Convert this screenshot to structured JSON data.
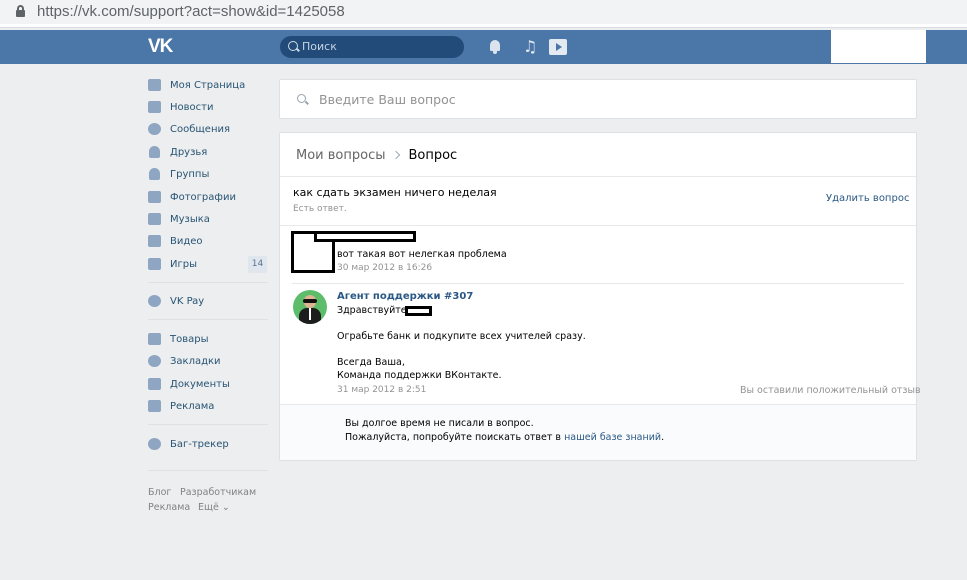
{
  "browser": {
    "url": "https://vk.com/support?act=show&id=1425058"
  },
  "header": {
    "logo": "VK",
    "search_placeholder": "Поиск"
  },
  "sidebar": {
    "items": [
      {
        "label": "Моя Страница",
        "icon": "home-icon"
      },
      {
        "label": "Новости",
        "icon": "news-icon"
      },
      {
        "label": "Сообщения",
        "icon": "messages-icon"
      },
      {
        "label": "Друзья",
        "icon": "friends-icon"
      },
      {
        "label": "Группы",
        "icon": "groups-icon"
      },
      {
        "label": "Фотографии",
        "icon": "camera-icon"
      },
      {
        "label": "Музыка",
        "icon": "music-icon"
      },
      {
        "label": "Видео",
        "icon": "video-icon"
      },
      {
        "label": "Игры",
        "icon": "games-icon",
        "badge": "14"
      }
    ],
    "pay": {
      "label": "VK Pay",
      "icon": "vkpay-icon"
    },
    "extra": [
      {
        "label": "Товары",
        "icon": "shopping-bag-icon"
      },
      {
        "label": "Закладки",
        "icon": "star-icon"
      },
      {
        "label": "Документы",
        "icon": "document-icon"
      },
      {
        "label": "Реклама",
        "icon": "megaphone-icon"
      }
    ],
    "bugtracker": {
      "label": "Баг-трекер",
      "icon": "bug-icon"
    },
    "footer": {
      "blog": "Блог",
      "developers": "Разработчикам",
      "ads": "Реклама",
      "more": "Ещё ⌄"
    }
  },
  "question_search": {
    "placeholder": "Введите Ваш вопрос"
  },
  "ticket": {
    "breadcrumb_parent": "Мои вопросы",
    "breadcrumb_current": "Вопрос",
    "title": "как сдать экзамен ничего неделая",
    "status": "Есть ответ.",
    "delete_label": "Удалить вопрос",
    "user_message": {
      "text": "вот такая вот нелегкая проблема",
      "time": "30 мар 2012 в 16:26"
    },
    "agent_message": {
      "name": "Агент поддержки #307",
      "greeting": "Здравствуйте,",
      "body": "Ограбьте банк и подкупите всех учителей сразу.",
      "sign_1": "Всегда Ваша,",
      "sign_2": "Команда поддержки ВКонтакте.",
      "time": "31 мар 2012 в 2:51",
      "feedback": "Вы оставили положительный отзыв"
    },
    "notice_line_1": "Вы долгое время не писали в вопрос.",
    "notice_line_2_prefix": "Пожалуйста, попробуйте поискать ответ в",
    "notice_link": "нашей базе знаний",
    "notice_suffix": "."
  },
  "colors": {
    "header": "#4a76a8",
    "link": "#2a5885",
    "background": "#edeef0"
  }
}
